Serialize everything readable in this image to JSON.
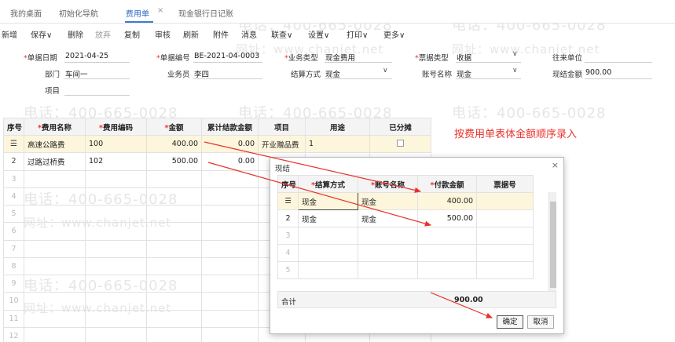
{
  "tabs": [
    {
      "label": "我的桌面"
    },
    {
      "label": "初始化导航"
    },
    {
      "label": "费用单"
    },
    {
      "label": "现金银行日记账"
    }
  ],
  "tab_close_glyph": "×",
  "toolbar": {
    "new": "新增",
    "save": "保存",
    "delete": "删除",
    "abandon": "放弃",
    "copy": "复制",
    "audit": "审核",
    "refresh": "刷新",
    "attach": "附件",
    "message": "消息",
    "query": "联查",
    "settings": "设置",
    "print": "打印",
    "more": "更多"
  },
  "form": {
    "doc_date_label": "单据日期",
    "doc_date": "2021-04-25",
    "doc_no_label": "单据编号",
    "doc_no": "BE-2021-04-0003",
    "biz_type_label": "业务类型",
    "biz_type": "现金费用",
    "invoice_type_label": "票据类型",
    "invoice_type": "收据",
    "partner_label": "往来单位",
    "dept_label": "部门",
    "dept": "车间一",
    "staff_label": "业务员",
    "staff": "李四",
    "settle_label": "结算方式",
    "settle": "现金",
    "account_label": "账号名称",
    "account": "现金",
    "cash_amount_label": "现结金额",
    "cash_amount": "900.00",
    "project_label": "项目"
  },
  "grid": {
    "headers": [
      "序号",
      "费用名称",
      "费用编码",
      "金额",
      "累计结款金额",
      "项目",
      "用途",
      "已分摊"
    ],
    "rows": [
      {
        "seq": "",
        "name": "高速公路费",
        "code": "100",
        "amount": "400.00",
        "paid": "0.00",
        "project": "开业赠品费",
        "use": "1"
      },
      {
        "seq": "2",
        "name": "过路过桥费",
        "code": "102",
        "amount": "500.00",
        "paid": "0.00",
        "project": "",
        "use": ""
      }
    ],
    "empty_rows": [
      "3",
      "4",
      "5",
      "6",
      "7",
      "8",
      "9",
      "10",
      "11",
      "12"
    ]
  },
  "note": "按费用单表体金额顺序录入",
  "dialog": {
    "title": "现结",
    "close": "×",
    "headers": [
      "序号",
      "结算方式",
      "账号名称",
      "付款金额",
      "票据号"
    ],
    "rows": [
      {
        "seq": "",
        "settle": "现金",
        "account": "现金",
        "amount": "400.00"
      },
      {
        "seq": "2",
        "settle": "现金",
        "account": "现金",
        "amount": "500.00"
      }
    ],
    "empty_rows": [
      "3",
      "4",
      "5"
    ],
    "total_label": "合计",
    "total": "900.00",
    "ok": "确定",
    "cancel": "取消"
  },
  "watermark_phone": "电话：400-665-0028",
  "watermark_site": "网址：www.chanjet.net",
  "colors": {
    "accent": "#2f6bc1",
    "annotation": "#e8322b",
    "selected_row": "#fdf6dc"
  }
}
